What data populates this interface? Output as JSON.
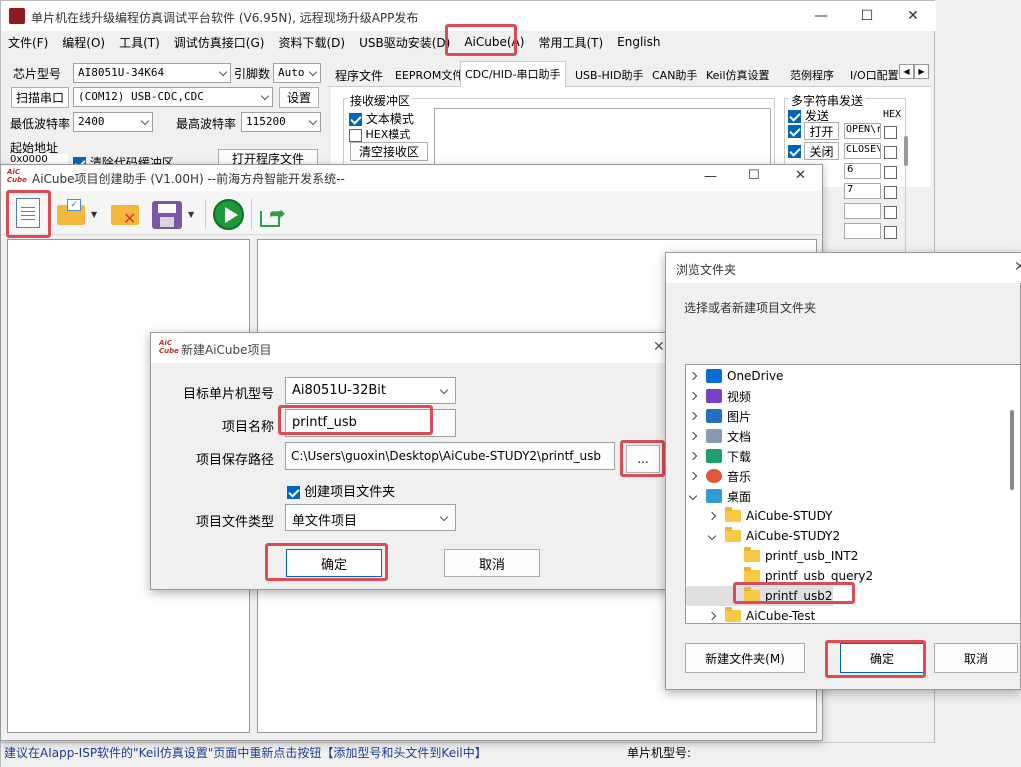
{
  "main_window": {
    "title": "单片机在线升级编程仿真调试平台软件 (V6.95N), 远程现场升级APP发布",
    "menu": [
      "文件(F)",
      "编程(O)",
      "工具(T)",
      "调试仿真接口(G)",
      "资料下载(D)",
      "USB驱动安装(D)",
      "AiCube(A)",
      "常用工具(T)",
      "English"
    ],
    "chip_label": "芯片型号",
    "chip_value": "AI8051U-34K64",
    "pin_label": "引脚数",
    "pin_value": "Auto",
    "scan_port_label": "扫描串口",
    "port_value": "(COM12) USB-CDC,CDC",
    "settings_label": "设置",
    "min_baud_label": "最低波特率",
    "min_baud_value": "2400",
    "max_baud_label": "最高波特率",
    "max_baud_value": "115200",
    "start_addr_label": "起始地址",
    "start_addr_value": "0x0000",
    "clear_code_label": "清除代码缓冲区",
    "open_prog_label": "打开程序文件",
    "tabs": [
      "程序文件",
      "EEPROM文件",
      "CDC/HID-串口助手",
      "USB-HID助手",
      "CAN助手",
      "Keil仿真设置",
      "范例程序",
      "I/O口配置"
    ],
    "recv_buffer_label": "接收缓冲区",
    "text_mode_label": "文本模式",
    "hex_mode_label": "HEX模式",
    "clear_recv_label": "清空接收区",
    "multi_send_label": "多字符串发送",
    "send_label": "发送",
    "hex_label": "HEX",
    "rows": [
      {
        "name": "打开",
        "value": "OPEN\\r"
      },
      {
        "name": "关闭",
        "value": "CLOSE\\"
      },
      {
        "name": "",
        "value": "6"
      },
      {
        "name": "",
        "value": "7"
      }
    ],
    "status_text": "建议在AIapp-ISP软件的\"Keil仿真设置\"页面中重新点击按钮【添加型号和头文件到Keil中】",
    "status_chip_label": "单片机型号:"
  },
  "aicube_window": {
    "logo": "AiC Cube",
    "title": "AiCube项目创建助手 (V1.00H) --前海方舟智能开发系统--"
  },
  "new_project_dialog": {
    "title": "新建AiCube项目",
    "target_mcu_label": "目标单片机型号",
    "target_mcu_value": "Ai8051U-32Bit",
    "project_name_label": "项目名称",
    "project_name_value": "printf_usb",
    "save_path_label": "项目保存路径",
    "save_path_value": "C:\\Users\\guoxin\\Desktop\\AiCube-STUDY2\\printf_usb",
    "browse_label": "...",
    "create_folder_label": "创建项目文件夹",
    "file_type_label": "项目文件类型",
    "file_type_value": "单文件项目",
    "ok_label": "确定",
    "cancel_label": "取消"
  },
  "browse_dialog": {
    "title": "浏览文件夹",
    "prompt": "选择或者新建项目文件夹",
    "tree": [
      {
        "label": "OneDrive",
        "icon": "cloud-icon",
        "level": 0,
        "expand": "collapsed"
      },
      {
        "label": "视频",
        "icon": "video-icon",
        "level": 0,
        "expand": "collapsed"
      },
      {
        "label": "图片",
        "icon": "image-icon",
        "level": 0,
        "expand": "collapsed"
      },
      {
        "label": "文档",
        "icon": "document-icon",
        "level": 0,
        "expand": "collapsed"
      },
      {
        "label": "下载",
        "icon": "download-icon",
        "level": 0,
        "expand": "collapsed"
      },
      {
        "label": "音乐",
        "icon": "music-icon",
        "level": 0,
        "expand": "collapsed"
      },
      {
        "label": "桌面",
        "icon": "desktop-icon",
        "level": 0,
        "expand": "expanded"
      },
      {
        "label": "AiCube-STUDY",
        "icon": "folder-icon",
        "level": 1,
        "expand": "collapsed"
      },
      {
        "label": "AiCube-STUDY2",
        "icon": "folder-icon",
        "level": 1,
        "expand": "expanded"
      },
      {
        "label": "printf_usb_INT2",
        "icon": "folder-icon",
        "level": 2,
        "expand": "none"
      },
      {
        "label": "printf_usb_query2",
        "icon": "folder-icon",
        "level": 2,
        "expand": "none"
      },
      {
        "label": "printf_usb2",
        "icon": "folder-icon",
        "level": 2,
        "expand": "none",
        "selected": true
      },
      {
        "label": "AiCube-Test",
        "icon": "folder-icon",
        "level": 1,
        "expand": "collapsed"
      }
    ],
    "new_folder_label": "新建文件夹(M)",
    "ok_label": "确定",
    "cancel_label": "取消"
  },
  "colors": {
    "highlight": "#e04a55",
    "accent": "#0067c0",
    "status_text": "#1a3c9e"
  }
}
